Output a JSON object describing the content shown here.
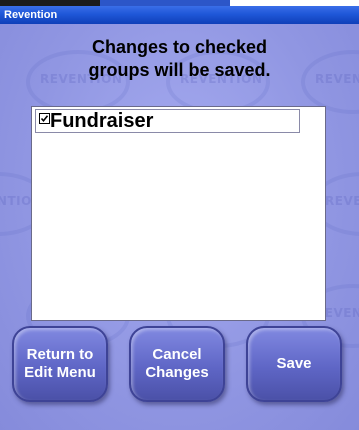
{
  "window": {
    "title": "Revention"
  },
  "watermark": {
    "text": "REVENTION"
  },
  "dialog": {
    "heading": "Changes to checked groups will be saved."
  },
  "group_list": {
    "items": [
      {
        "label": "Fundraiser",
        "checked": true,
        "check_glyph": "☑"
      }
    ]
  },
  "buttons": {
    "return_label": "Return to\nEdit Menu",
    "cancel_label": "Cancel\nChanges",
    "save_label": "Save"
  },
  "colors": {
    "title_bar": "#1f57d8",
    "background": "#9096e2",
    "button": "#5f66c6"
  }
}
